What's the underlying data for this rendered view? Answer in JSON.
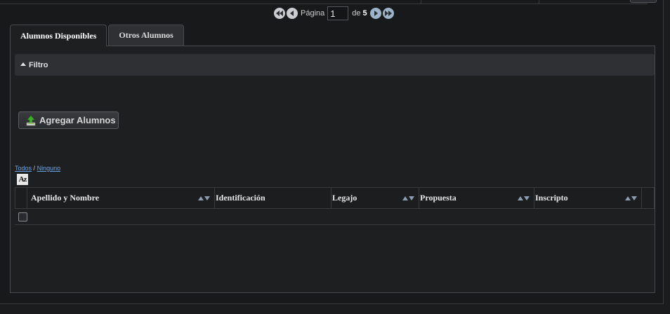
{
  "pager": {
    "label": "Página",
    "current": "1",
    "of_label": "de",
    "total": "5"
  },
  "tabs": [
    {
      "label": "Alumnos Disponibles",
      "active": true
    },
    {
      "label": "Otros Alumnos",
      "active": false
    }
  ],
  "filter": {
    "label": "Filtro"
  },
  "add_button": {
    "label": "Agregar Alumnos"
  },
  "selection": {
    "all": "Todos",
    "separator": "/",
    "none": "Ninguno"
  },
  "grid": {
    "columns": [
      "Apellido y Nombre",
      "Identificación",
      "Legajo",
      "Propuesta",
      "Inscripto"
    ]
  },
  "colors": {
    "background": "#1b1c1e",
    "panel": "#1e1f21",
    "link": "#6aa6e6"
  }
}
